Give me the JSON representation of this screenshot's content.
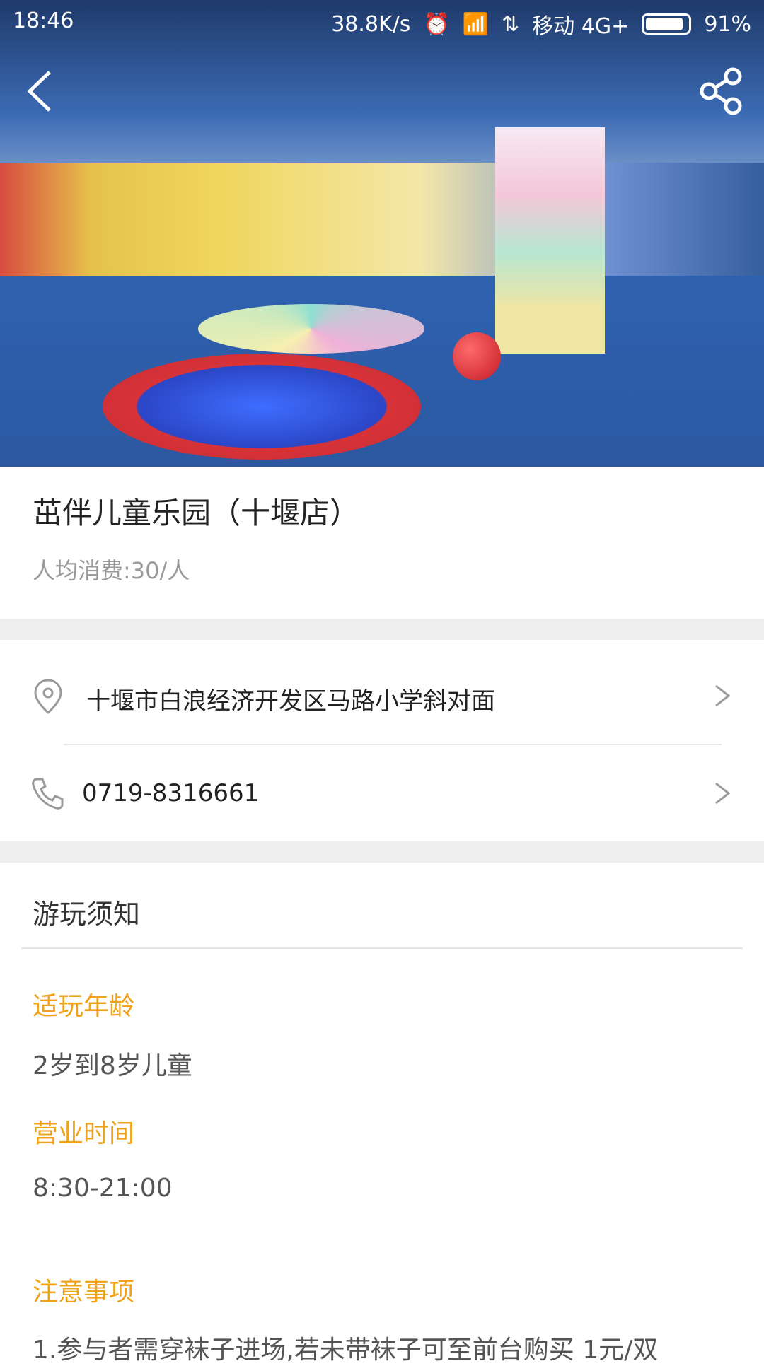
{
  "status_bar": {
    "time": "18:46",
    "net_speed": "38.8K/s",
    "carrier": "移动 4G+",
    "battery": "91%"
  },
  "hero": {
    "image_alt": ""
  },
  "place": {
    "title": "茁伴儿童乐园（十堰店）",
    "avg_price": "人均消费:30/人"
  },
  "contact": {
    "address": "十堰市白浪经济开发区马路小学斜对面",
    "phone": "0719-8316661"
  },
  "notice": {
    "heading": "游玩须知",
    "age_label": "适玩年龄",
    "age_value": "2岁到8岁儿童",
    "hours_label": "营业时间",
    "hours_value": "8:30-21:00",
    "notes_label": "注意事项",
    "notes_line1": "1.参与者需穿袜子进场,若未带袜子可至前台购买 1元/双"
  },
  "colors": {
    "accent": "#f0a21a",
    "separator": "#eeeeee"
  }
}
